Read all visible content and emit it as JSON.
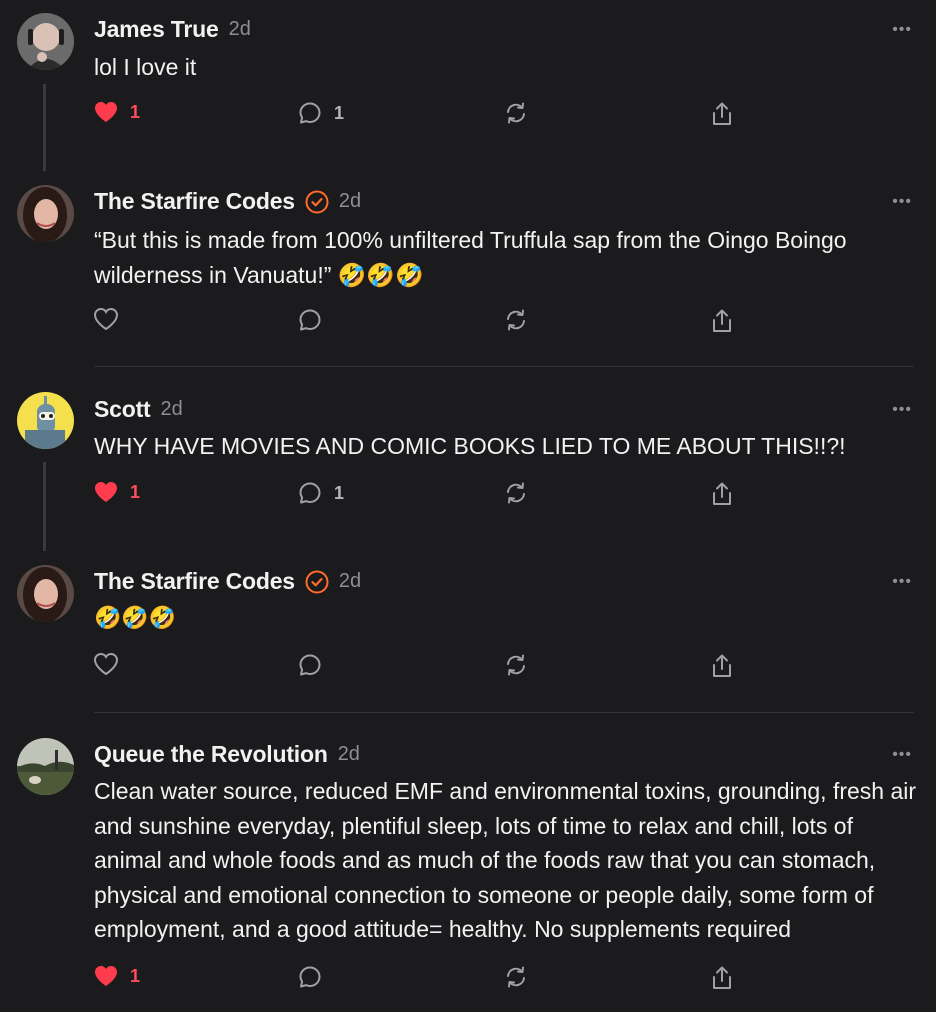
{
  "colors": {
    "background": "#1b1b1d",
    "like_active": "#ff3b4e",
    "verified": "#ff6b2b",
    "muted": "#8e8e93"
  },
  "comments": [
    {
      "author": "James True",
      "time": "2d",
      "verified": false,
      "text": "lol I love it",
      "liked": true,
      "like_count": "1",
      "reply_count": "1",
      "avatar": "bald-man-headphones"
    },
    {
      "author": "The Starfire Codes",
      "time": "2d",
      "verified": true,
      "text": "“But this is made from 100% unfiltered Truffula sap from the Oingo Boingo wilderness in Vanuatu!” 🤣🤣🤣",
      "liked": false,
      "like_count": "",
      "reply_count": "",
      "avatar": "woman-dark-hair"
    },
    {
      "author": "Scott",
      "time": "2d",
      "verified": false,
      "text": "WHY HAVE MOVIES AND COMIC BOOKS LIED TO ME ABOUT THIS!!?!",
      "liked": true,
      "like_count": "1",
      "reply_count": "1",
      "avatar": "robot-cartoon"
    },
    {
      "author": "The Starfire Codes",
      "time": "2d",
      "verified": true,
      "text": "🤣🤣🤣",
      "liked": false,
      "like_count": "",
      "reply_count": "",
      "avatar": "woman-dark-hair"
    },
    {
      "author": "Queue the Revolution",
      "time": "2d",
      "verified": false,
      "text": "Clean water source, reduced EMF and environmental toxins, grounding, fresh air and sunshine everyday, plentiful sleep, lots of time to relax and chill, lots of animal and whole foods and as much of the foods raw that you can stomach, physical and emotional connection to someone or people daily, some form of employment, and a good attitude= healthy. No supplements required",
      "liked": true,
      "like_count": "1",
      "reply_count": "",
      "avatar": "landscape-photo"
    }
  ],
  "icons": {
    "more": "more-horizontal-icon",
    "like": "heart-icon",
    "reply": "speech-bubble-icon",
    "restack": "restack-arrows-icon",
    "share": "share-upload-icon"
  },
  "more_label": "•••"
}
